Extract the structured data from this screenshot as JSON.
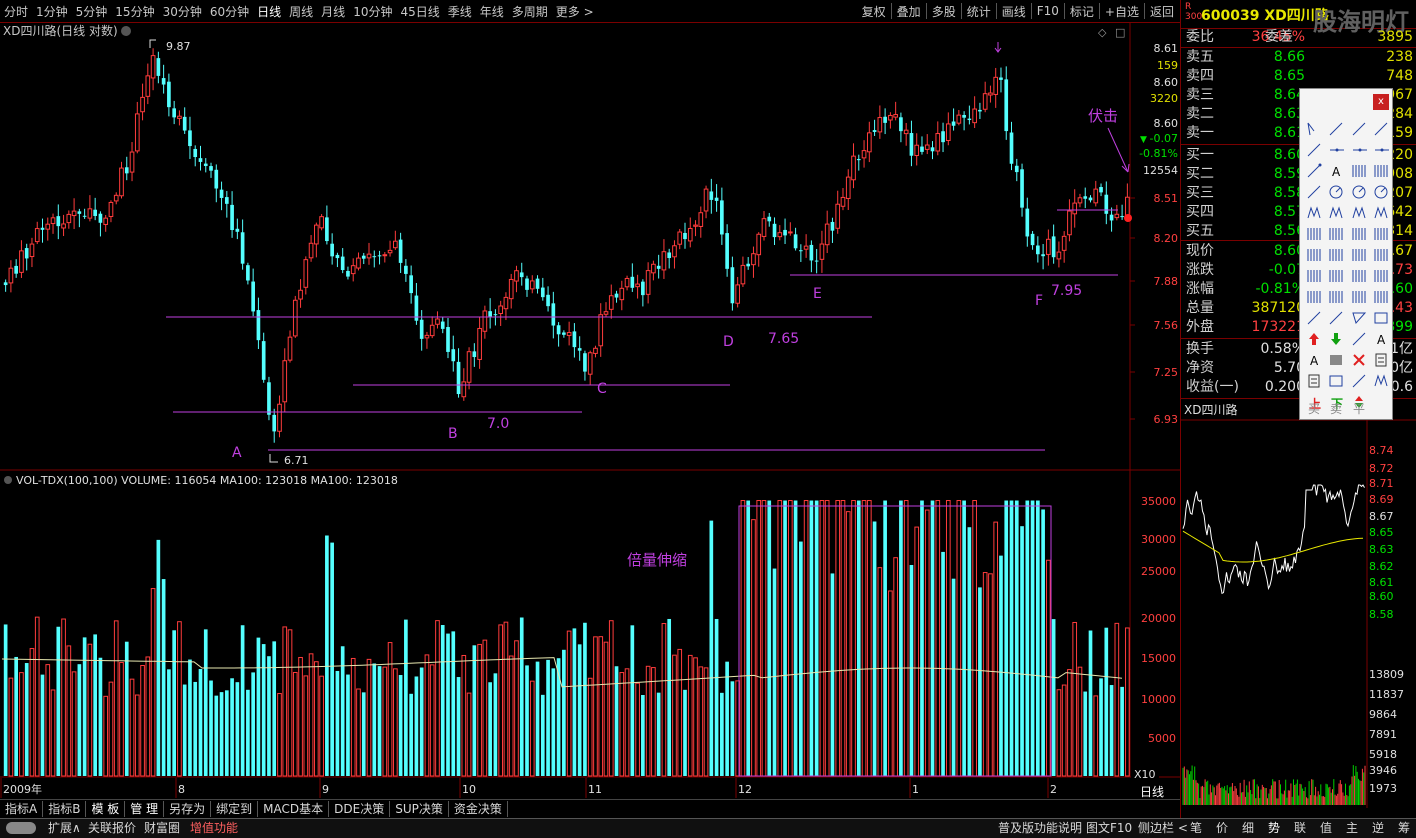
{
  "topbar": {
    "periods": [
      "分时",
      "1分钟",
      "5分钟",
      "15分钟",
      "30分钟",
      "60分钟",
      "日线",
      "周线",
      "月线",
      "10分钟",
      "45日线",
      "季线",
      "年线",
      "多周期",
      "更多 >"
    ],
    "active_period": "日线",
    "tools": [
      "复权",
      "叠加",
      "多股",
      "统计",
      "画线",
      "F10",
      "标记",
      "+自选",
      "返回"
    ]
  },
  "main_chart": {
    "title": "XD四川路(日线 对数)",
    "price_ticks": [
      "8.61",
      "159",
      "8.60",
      "3220",
      "8.60",
      "-0.07",
      "-0.81%",
      "12554",
      "8.51",
      "8.20",
      "7.88",
      "7.56",
      "7.25",
      "6.93"
    ],
    "price_axis": [
      "8.51",
      "8.20",
      "7.88",
      "7.56",
      "7.25",
      "6.93"
    ],
    "high_label": "9.87",
    "low_label": "6.71",
    "annotations": {
      "A": "A",
      "B": "B",
      "C": "C",
      "D": "D",
      "E": "E",
      "F": "F",
      "v70": "7.0",
      "v765": "7.65",
      "v795": "7.95",
      "fuji": "伏击",
      "beiliang": "倍量伸缩"
    }
  },
  "volume_chart": {
    "title": "VOL-TDX(100,100) VOLUME: 116054 MA100: 123018 MA100: 123018",
    "axis": [
      "35000",
      "30000",
      "25000",
      "20000",
      "15000",
      "10000",
      "5000"
    ],
    "multiplier": "X10"
  },
  "date_axis": [
    "2009年",
    "8",
    "9",
    "10",
    "11",
    "12",
    "1",
    "2"
  ],
  "candles": {
    "count": 214,
    "seed": 17
  },
  "stock": {
    "code_name": "600039 XD四川路",
    "r_label": "R",
    "r_num": "300",
    "logo": "股海明灯",
    "weibi_label": "委比",
    "weibi_pct": "36.45%",
    "weibi_diff": "委差",
    "weibi_val": "3895",
    "sells": [
      {
        "label": "卖五",
        "price": "8.66",
        "vol": "238"
      },
      {
        "label": "卖四",
        "price": "8.65",
        "vol": "748"
      },
      {
        "label": "卖三",
        "price": "8.64",
        "vol": "967"
      },
      {
        "label": "卖二",
        "price": "8.63",
        "vol": "284"
      },
      {
        "label": "卖一",
        "price": "8.61",
        "vol": "159"
      }
    ],
    "buys": [
      {
        "label": "买一",
        "price": "8.60",
        "vol": "220"
      },
      {
        "label": "买二",
        "price": "8.59",
        "vol": "908"
      },
      {
        "label": "买三",
        "price": "8.58",
        "vol": "207"
      },
      {
        "label": "买四",
        "price": "8.57",
        "vol": "642"
      },
      {
        "label": "买五",
        "price": "8.56",
        "vol": "314"
      }
    ],
    "quote": [
      {
        "label": "现价",
        "val": "8.60",
        "right": "3.67"
      },
      {
        "label": "涨跌",
        "val": "-0.07",
        "right": "8.73"
      },
      {
        "label": "涨幅",
        "val": "-0.81%",
        "right": "8.60"
      },
      {
        "label": "总量",
        "val": "387120",
        "right": ".43"
      },
      {
        "label": "外盘",
        "val": "173221",
        "right": "899"
      }
    ],
    "extra": [
      {
        "label": "换手",
        "val": "0.58%",
        "right": "1亿"
      },
      {
        "label": "净资",
        "val": "5.70",
        "right": "0亿"
      },
      {
        "label": "收益(一)",
        "val": "0.200",
        "right": "0.6"
      }
    ],
    "mini_title": "XD四川路",
    "mini_axis": [
      "8.74",
      "8.72",
      "8.71",
      "8.69",
      "8.67",
      "8.65",
      "8.63",
      "8.62",
      "8.61",
      "8.60",
      "8.58"
    ],
    "mini_vol_axis": [
      "13809",
      "11837",
      "9864",
      "7891",
      "5918",
      "3946",
      "1973"
    ]
  },
  "tool_popup": {
    "close": "x",
    "labels": [
      "买",
      "卖",
      "平"
    ]
  },
  "bottom1": [
    "指标A",
    "指标B",
    "模 板",
    "管 理",
    "另存为",
    "绑定到",
    "MACD基本",
    "DDE决策",
    "SUP决策",
    "资金决策"
  ],
  "bottom1_right": "日线",
  "bottom2": [
    "扩展∧",
    "关联报价",
    "财富圈",
    "增值功能"
  ],
  "bottom2_right": [
    "普及版功能说明",
    "图文F10",
    "侧边栏 <"
  ],
  "bottom2_tabs": [
    "笔",
    "价",
    "细",
    "势",
    "联",
    "值",
    "主",
    "逆",
    "筹"
  ],
  "colors": {
    "up": "#ff3c3c",
    "down": "#54ffff",
    "ma": "#e8e8b0",
    "annot": "#c040e0",
    "bg": "#000000"
  }
}
